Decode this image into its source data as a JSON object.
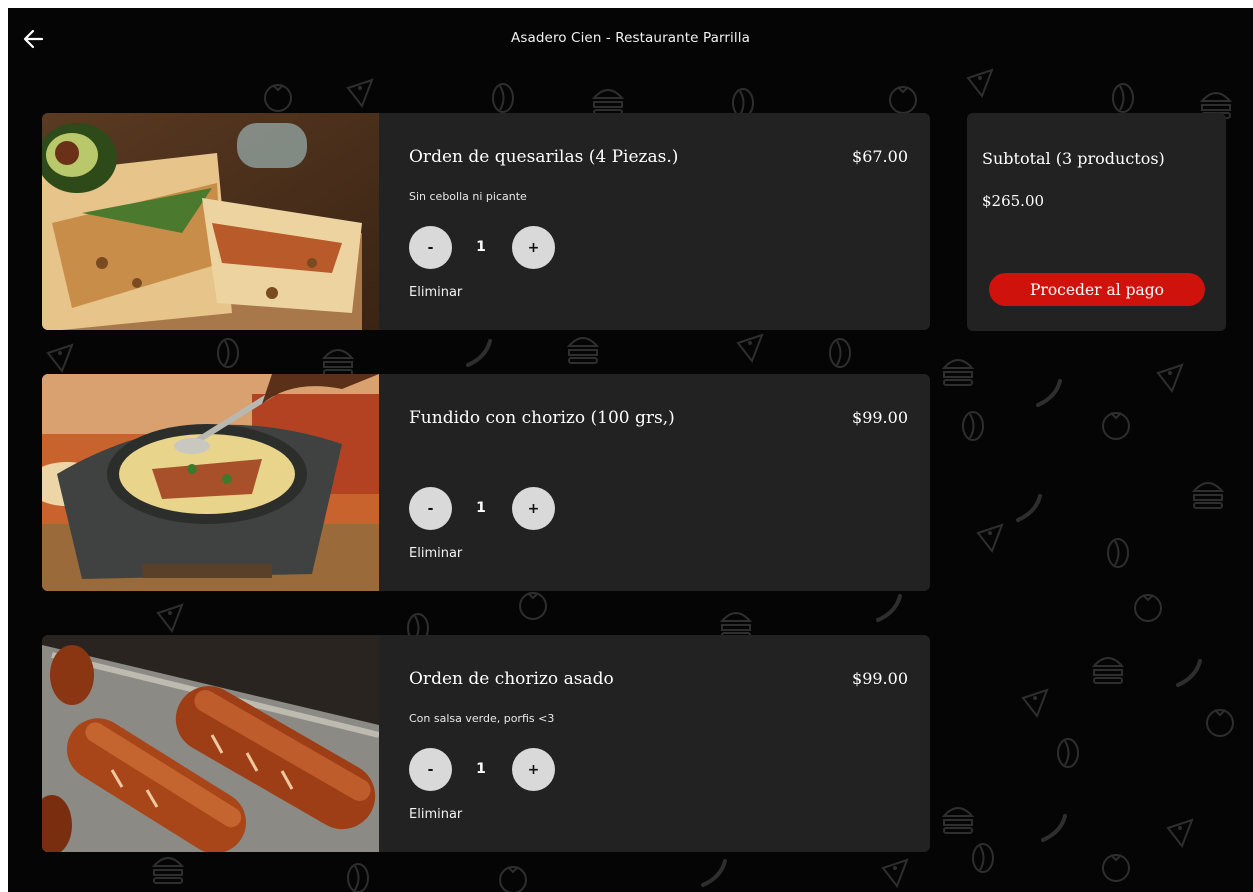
{
  "header": {
    "back_icon": "arrow-left-icon",
    "title": "Asadero Cien - Restaurante Parrilla"
  },
  "cart": {
    "items": [
      {
        "name": "Orden de quesarilas (4 Piezas.)",
        "price": "$67.00",
        "note": "Sin cebolla ni picante",
        "quantity": "1",
        "minus_label": "-",
        "plus_label": "+",
        "remove_label": "Eliminar"
      },
      {
        "name": "Fundido con chorizo (100 grs,)",
        "price": "$99.00",
        "note": "",
        "quantity": "1",
        "minus_label": "-",
        "plus_label": "+",
        "remove_label": "Eliminar"
      },
      {
        "name": "Orden de chorizo asado",
        "price": "$99.00",
        "note": "Con salsa verde, porfis <3",
        "quantity": "1",
        "minus_label": "-",
        "plus_label": "+",
        "remove_label": "Eliminar"
      }
    ]
  },
  "summary": {
    "title": "Subtotal (3 productos)",
    "amount": "$265.00",
    "checkout_label": "Proceder al pago"
  },
  "colors": {
    "background": "#050505",
    "card": "#222222",
    "accent": "#d0120c",
    "qty_button": "#d9d9d9"
  }
}
